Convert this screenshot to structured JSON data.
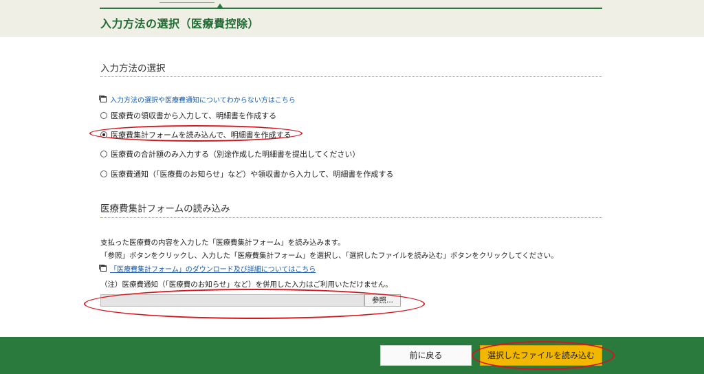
{
  "header": {
    "title": "入力方法の選択（医療費控除）"
  },
  "input_method": {
    "section_title": "入力方法の選択",
    "help_link": "入力方法の選択や医療費通知についてわからない方はこちら",
    "options": [
      {
        "label": "医療費の領収書から入力して、明細書を作成する",
        "checked": false
      },
      {
        "label": "医療費集計フォームを読み込んで、明細書を作成する",
        "checked": true
      },
      {
        "label": "医療費の合計額のみ入力する（別途作成した明細書を提出してください）",
        "checked": false
      },
      {
        "label": "医療費通知（「医療費のお知らせ」など）や領収書から入力して、明細書を作成する",
        "checked": false
      }
    ]
  },
  "form_load": {
    "section_title": "医療費集計フォームの読み込み",
    "description_1": "支払った医療費の内容を入力した「医療費集計フォーム」を読み込みます。",
    "description_2": "「参照」ボタンをクリックし、入力した「医療費集計フォーム」を選択し、「選択したファイルを読み込む」ボタンをクリックしてください。",
    "download_link": "「医療費集計フォーム」のダウンロード及び詳細についてはこちら",
    "note": "（注）医療費通知（「医療費のお知らせ」など）を併用した入力はご利用いただけません。",
    "file_value": "",
    "browse_label": "参照..."
  },
  "footer": {
    "back_label": "前に戻る",
    "load_label": "選択したファイルを読み込む"
  },
  "colors": {
    "brand_green": "#2b7a3d",
    "load_button": "#f2b800",
    "annotation_red": "#d7141e",
    "link_blue": "#1a5aa8"
  }
}
